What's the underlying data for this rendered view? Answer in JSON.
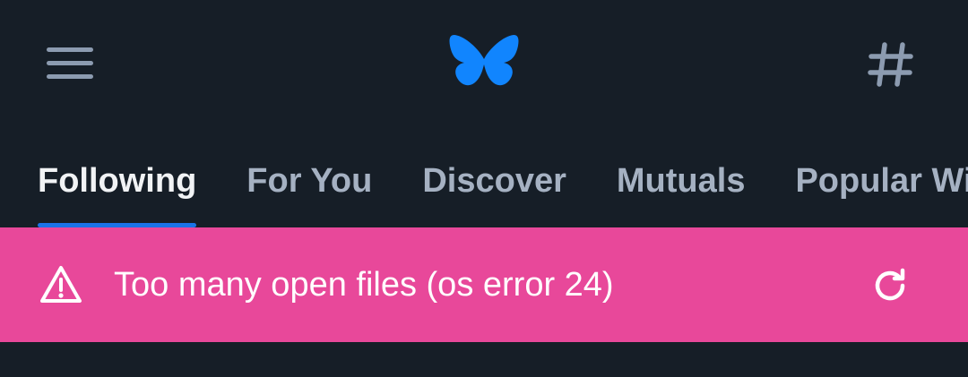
{
  "header": {
    "menu_icon": "hamburger-menu-icon",
    "logo_icon": "butterfly-logo-icon",
    "feeds_icon": "hashtag-icon",
    "logo_color": "#1185fe"
  },
  "tabs": [
    {
      "label": "Following",
      "active": true
    },
    {
      "label": "For You",
      "active": false
    },
    {
      "label": "Discover",
      "active": false
    },
    {
      "label": "Mutuals",
      "active": false
    },
    {
      "label": "Popular With Friends",
      "active": false
    }
  ],
  "error_banner": {
    "icon": "warning-triangle-icon",
    "message": "Too many open files (os error 24)",
    "retry_icon": "retry-icon",
    "background": "#e8489a"
  },
  "colors": {
    "background": "#161e27",
    "tab_active": "#f1f3f5",
    "tab_inactive": "#a5b1c2",
    "tab_indicator": "#1a73e8"
  }
}
